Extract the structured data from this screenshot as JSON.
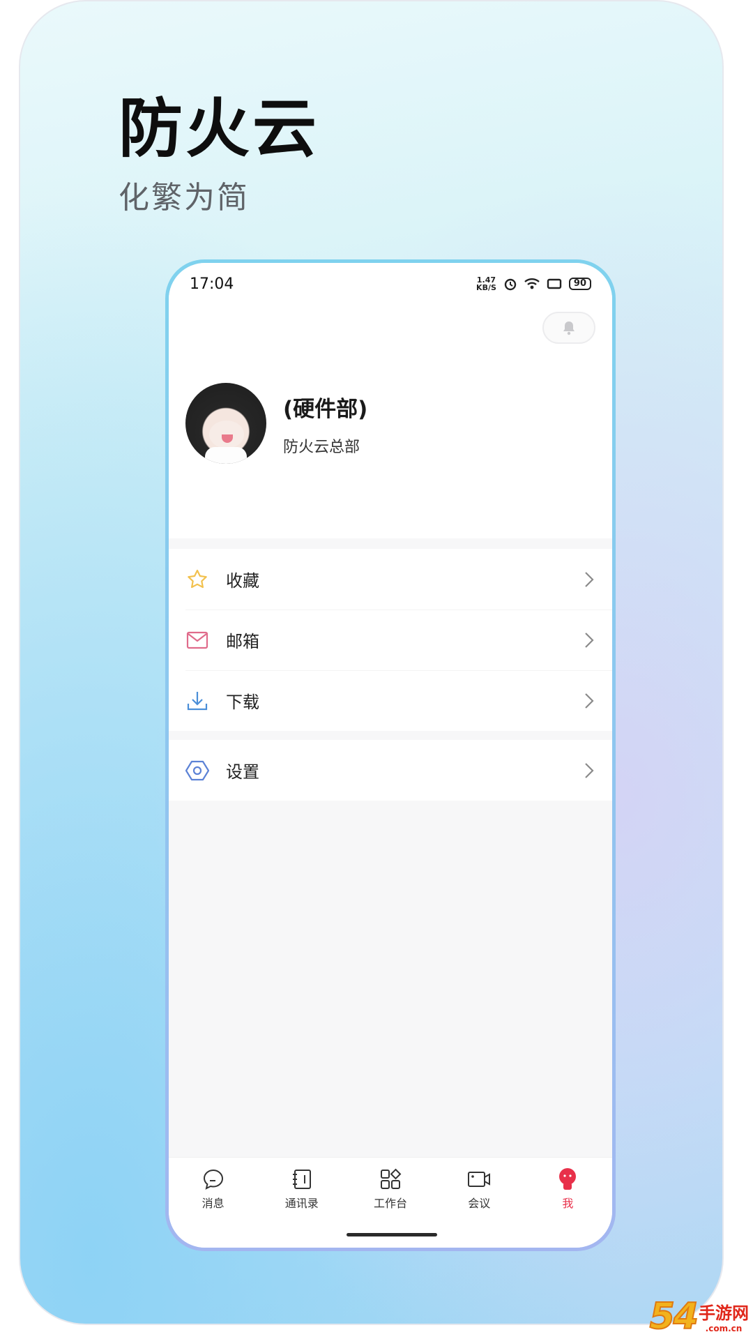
{
  "promo": {
    "title": "防火云",
    "subtitle": "化繁为简"
  },
  "status_bar": {
    "time": "17:04",
    "net_speed_value": "1.47",
    "net_speed_unit": "KB/S",
    "battery": "90"
  },
  "profile": {
    "name": "(硬件部)",
    "org": "防火云总部"
  },
  "menu": {
    "group1": [
      {
        "label": "收藏",
        "icon": "star-icon"
      },
      {
        "label": "邮箱",
        "icon": "mail-icon"
      },
      {
        "label": "下载",
        "icon": "download-icon"
      }
    ],
    "group2": [
      {
        "label": "设置",
        "icon": "settings-icon"
      }
    ]
  },
  "tabs": [
    {
      "label": "消息",
      "icon": "chat-icon"
    },
    {
      "label": "通讯录",
      "icon": "contacts-icon"
    },
    {
      "label": "工作台",
      "icon": "apps-icon"
    },
    {
      "label": "会议",
      "icon": "video-icon"
    },
    {
      "label": "我",
      "icon": "profile-icon",
      "active": true
    }
  ],
  "colors": {
    "accent_active": "#e8304a",
    "star": "#f2c14e",
    "mail": "#e06b8b",
    "download": "#4a8ed8",
    "settings": "#5c82d6"
  },
  "watermark": {
    "number": "54",
    "brand": "手游网",
    "domain": ".com.cn"
  }
}
